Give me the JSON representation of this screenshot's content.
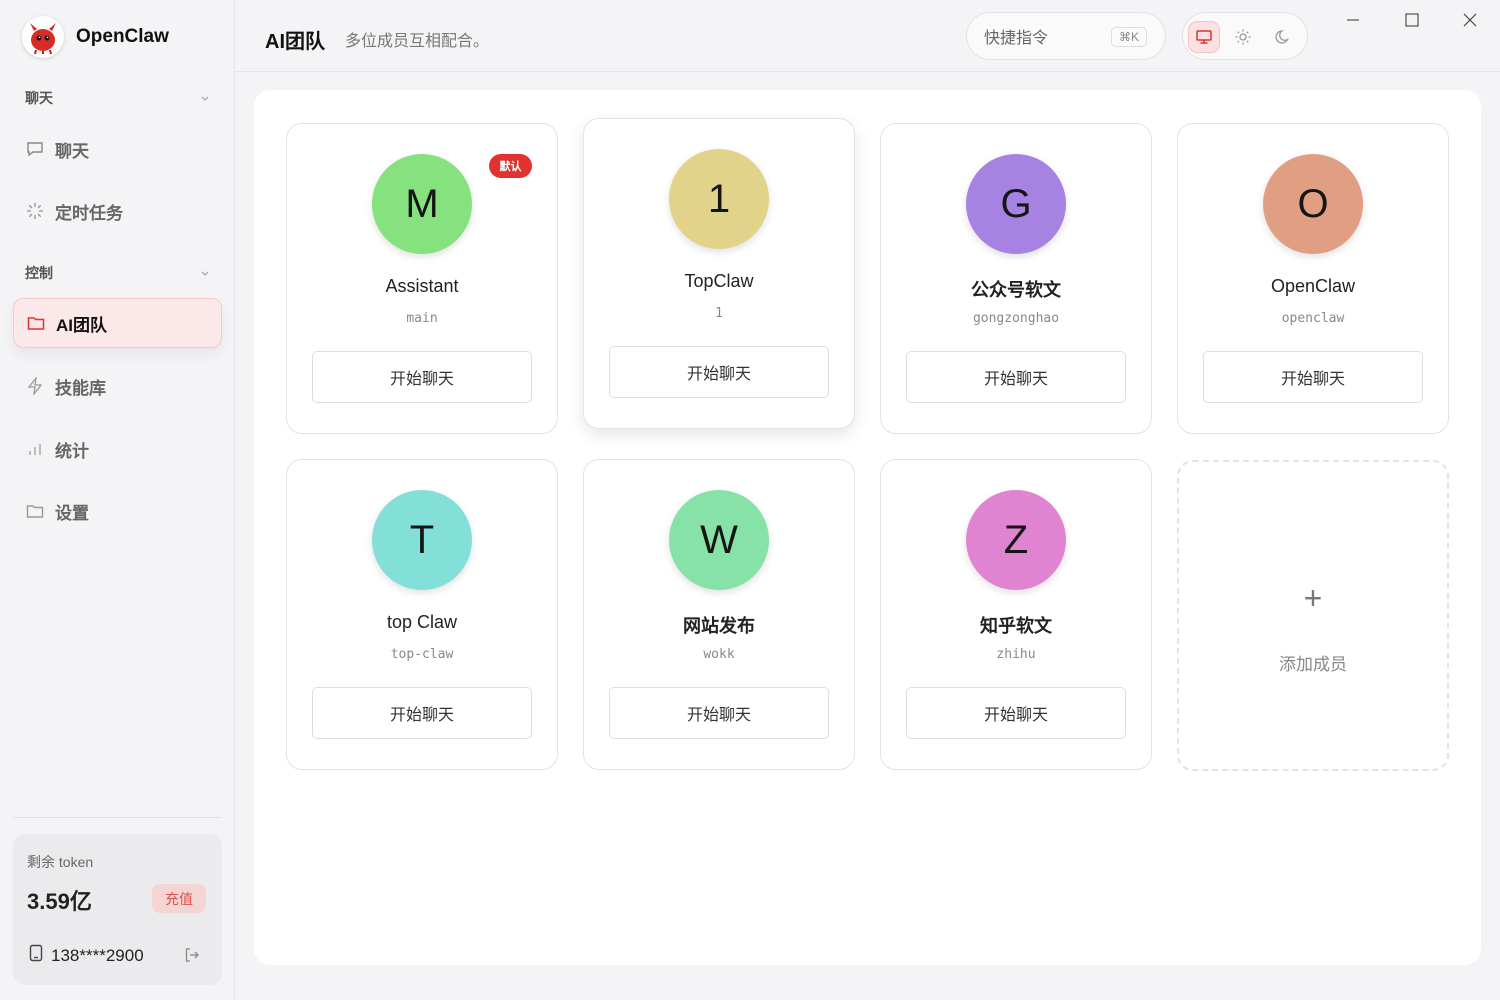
{
  "app": {
    "name": "OpenClaw"
  },
  "sidebar": {
    "sections": [
      {
        "title": "聊天",
        "items": [
          "聊天",
          "定时任务"
        ]
      },
      {
        "title": "控制",
        "items": [
          "AI团队",
          "技能库",
          "统计",
          "设置"
        ]
      }
    ],
    "token": {
      "label": "剩余 token",
      "value": "3.59亿",
      "recharge": "充值"
    },
    "account": "138****2900"
  },
  "header": {
    "title": "AI团队",
    "subtitle": "多位成员互相配合。",
    "quick_command_placeholder": "快捷指令",
    "shortcut": "⌘K"
  },
  "members": [
    {
      "initial": "M",
      "name": "Assistant",
      "id": "main",
      "color": "#86e17f",
      "badge": "默认",
      "button": "开始聊天"
    },
    {
      "initial": "1",
      "name": "TopClaw",
      "id": "1",
      "color": "#e2d38a",
      "button": "开始聊天"
    },
    {
      "initial": "G",
      "name": "公众号软文",
      "id": "gongzonghao",
      "color": "#a683e2",
      "button": "开始聊天"
    },
    {
      "initial": "O",
      "name": "OpenClaw",
      "id": "openclaw",
      "color": "#e09f82",
      "button": "开始聊天"
    },
    {
      "initial": "T",
      "name": "top Claw",
      "id": "top-claw",
      "color": "#82e0d8",
      "button": "开始聊天"
    },
    {
      "initial": "W",
      "name": "网站发布",
      "id": "wokk",
      "color": "#86e2a7",
      "button": "开始聊天"
    },
    {
      "initial": "Z",
      "name": "知乎软文",
      "id": "zhihu",
      "color": "#e083d0",
      "button": "开始聊天"
    }
  ],
  "add_member": {
    "plus": "+",
    "label": "添加成员"
  }
}
